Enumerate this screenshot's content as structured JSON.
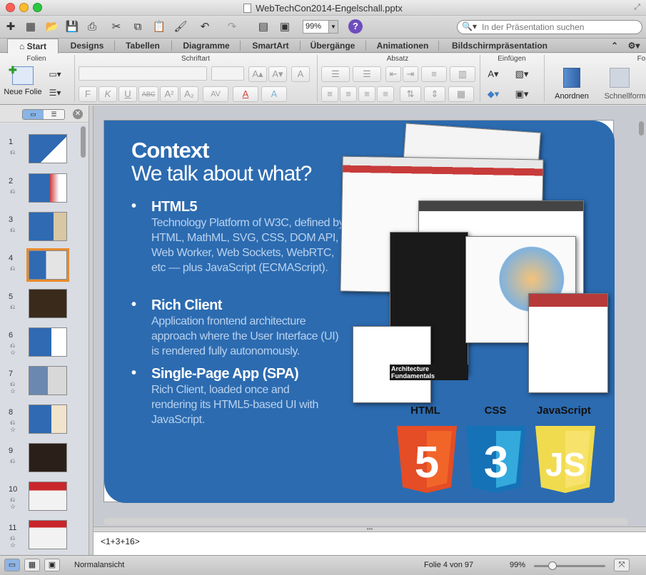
{
  "window": {
    "title": "WebTechCon2014-Engelschall.pptx"
  },
  "toolbar": {
    "zoom": "99%",
    "search_placeholder": "In der Präsentation suchen"
  },
  "tabs": [
    "Start",
    "Designs",
    "Tabellen",
    "Diagramme",
    "SmartArt",
    "Übergänge",
    "Animationen",
    "Bildschirmpräsentation"
  ],
  "ribbon": {
    "groups": [
      "Folien",
      "Schriftart",
      "Absatz",
      "Einfügen"
    ],
    "group_cut": "Fo",
    "new_slide": "Neue Folie",
    "arrange": "Anordnen",
    "quick_styles": "Schnellform",
    "font_buttons": [
      "F",
      "K",
      "U",
      "ABC",
      "A²",
      "A₂",
      "AV",
      "A",
      "A"
    ]
  },
  "slides": {
    "numbers": [
      "1",
      "2",
      "3",
      "4",
      "5",
      "6",
      "7",
      "8",
      "9",
      "10",
      "11"
    ],
    "selected": 4
  },
  "slide": {
    "title": "Context",
    "subtitle": "We talk about what?",
    "bullets": [
      {
        "head": "HTML5",
        "body": "Technology Platform of W3C, defined by HTML, MathML, SVG, CSS, DOM API, Web Worker, Web Sockets, WebRTC, etc — plus JavaScript (ECMAScript)."
      },
      {
        "head": "Rich Client",
        "body": "Application frontend architecture approach where the User Interface (UI) is rendered fully autonomously."
      },
      {
        "head": "Single-Page App (SPA)",
        "body": "Rich Client, loaded once and rendering its HTML5-based UI with JavaScript."
      }
    ],
    "screenshot_label": "Architecture Fundamentals",
    "logos": [
      {
        "label": "HTML",
        "glyph": "5",
        "color": "#e44d26",
        "dark": "#f16529"
      },
      {
        "label": "CSS",
        "glyph": "3",
        "color": "#1572b6",
        "dark": "#33a9dc"
      },
      {
        "label": "JavaScript",
        "glyph": "JS",
        "color": "#f0db4f",
        "dark": "#f7e36b"
      }
    ]
  },
  "notes": "<1+3+16>",
  "status": {
    "view": "Normalansicht",
    "slide_pos": "Folie 4 von 97",
    "zoom": "99%"
  }
}
